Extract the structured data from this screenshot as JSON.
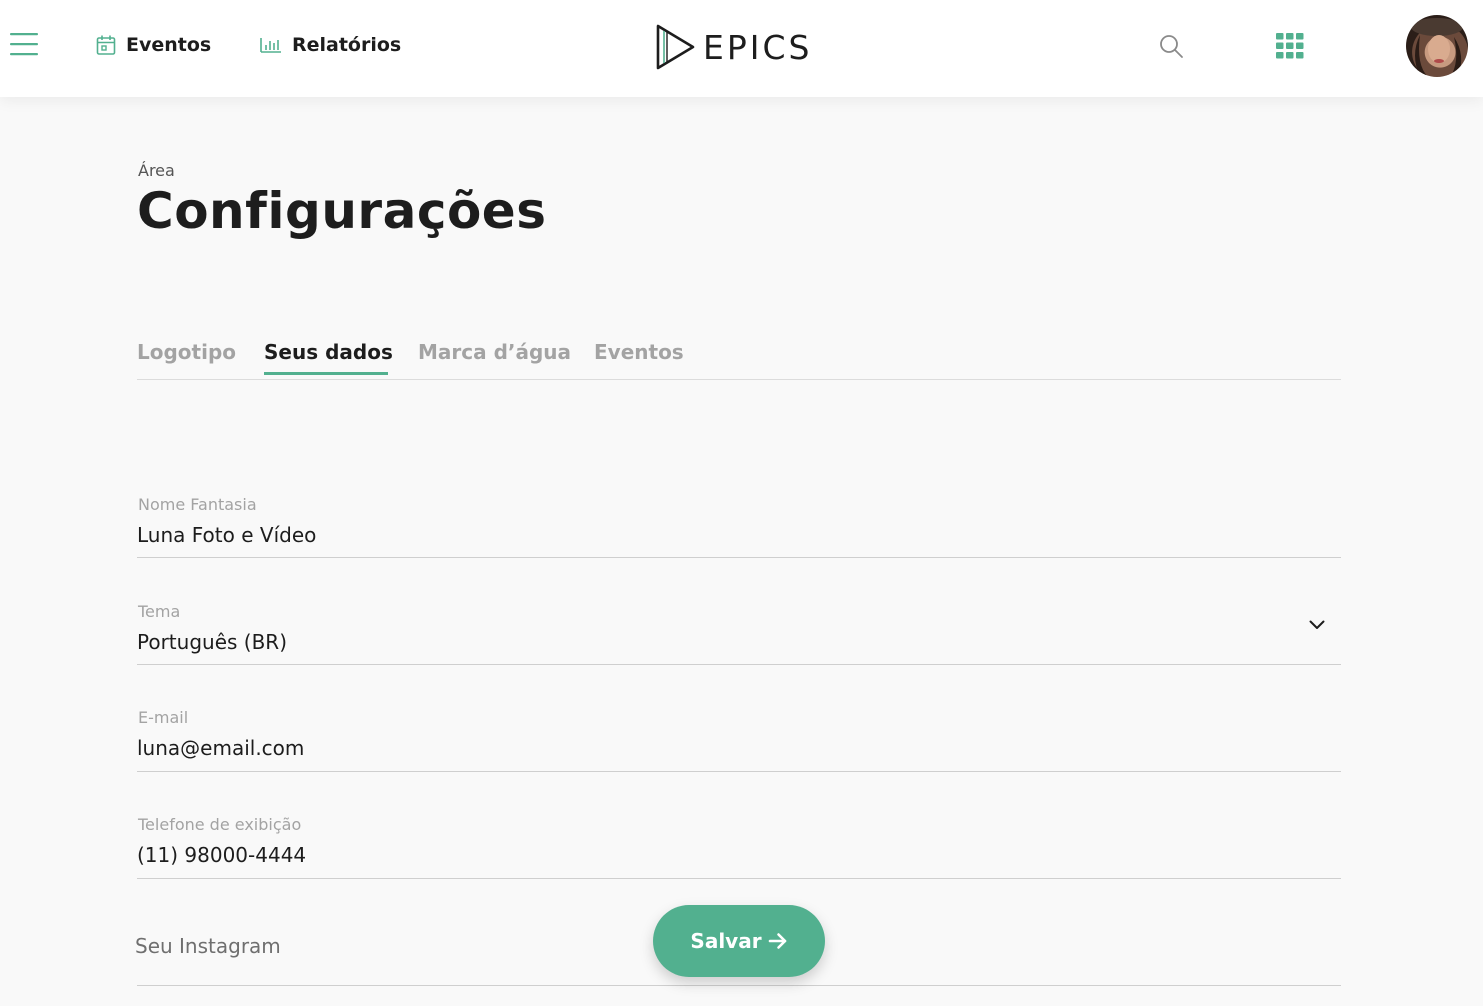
{
  "header": {
    "nav": [
      {
        "label": "Eventos",
        "icon": "calendar-icon"
      },
      {
        "label": "Relatórios",
        "icon": "bar-chart-icon"
      }
    ],
    "logo_text": "EPICS",
    "icons": {
      "menu": "hamburger-icon",
      "search": "search-icon",
      "apps": "apps-grid-icon",
      "avatar": "avatar"
    }
  },
  "page": {
    "breadcrumb": "Área",
    "title": "Configurações"
  },
  "tabs": [
    {
      "label": "Logotipo",
      "active": false
    },
    {
      "label": "Seus dados",
      "active": true
    },
    {
      "label": "Marca d’água",
      "active": false
    },
    {
      "label": "Eventos",
      "active": false
    }
  ],
  "form": {
    "nome_fantasia": {
      "label": "Nome Fantasia",
      "value": "Luna Foto e Vídeo"
    },
    "tema": {
      "label": "Tema",
      "value": "Português (BR)"
    },
    "email": {
      "label": "E-mail",
      "value": "luna@email.com"
    },
    "telefone": {
      "label": "Telefone de exibição",
      "value": "(11) 98000-4444"
    },
    "instagram": {
      "placeholder": "Seu Instagram"
    }
  },
  "actions": {
    "save_label": "Salvar"
  },
  "colors": {
    "accent": "#52b08f",
    "text": "#1d1d1d",
    "muted": "#a3a3a3",
    "background": "#f9f9f9"
  }
}
